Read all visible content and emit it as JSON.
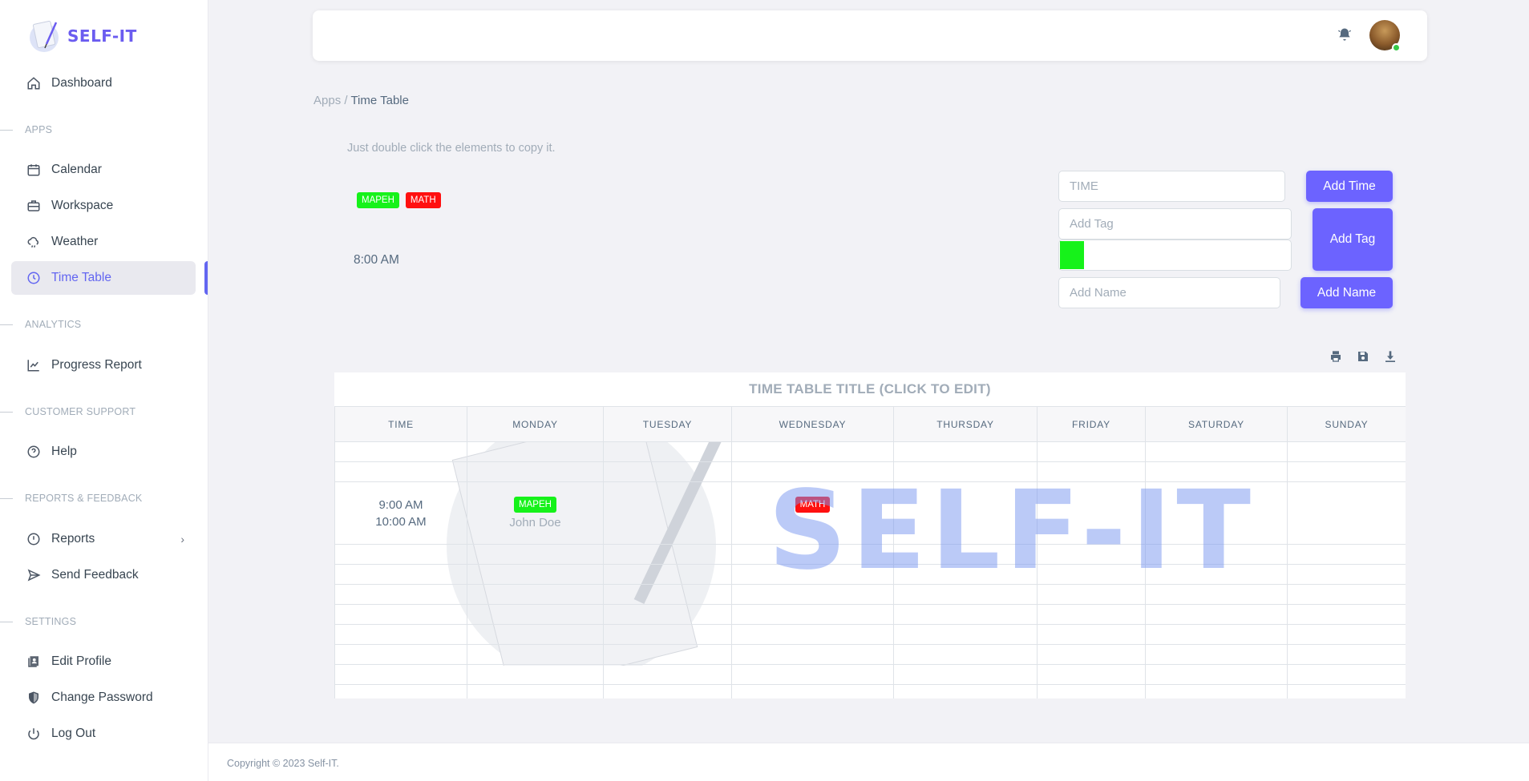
{
  "brand": {
    "name": "SELF-IT"
  },
  "sidebar": {
    "dashboard": "Dashboard",
    "sections": {
      "apps": "APPS",
      "analytics": "ANALYTICS",
      "support": "CUSTOMER SUPPORT",
      "reports": "REPORTS & FEEDBACK",
      "settings": "SETTINGS"
    },
    "items": {
      "calendar": "Calendar",
      "workspace": "Workspace",
      "weather": "Weather",
      "timetable": "Time Table",
      "progress": "Progress Report",
      "help": "Help",
      "reports": "Reports",
      "feedback": "Send Feedback",
      "edit_profile": "Edit Profile",
      "change_password": "Change Password",
      "logout": "Log Out"
    }
  },
  "breadcrumb": {
    "parent": "Apps /",
    "current": "Time Table"
  },
  "hint": "Just double click the elements to copy it.",
  "palette": {
    "tags": [
      {
        "label": "MAPEH",
        "color": "#16f21a"
      },
      {
        "label": "MATH",
        "color": "#ff1010"
      }
    ],
    "time": "8:00 AM"
  },
  "form": {
    "time_placeholder": "TIME",
    "tag_placeholder": "Add Tag",
    "name_placeholder": "Add Name",
    "selected_color": "#16f21a",
    "add_time": "Add Time",
    "add_tag": "Add Tag",
    "add_name": "Add Name"
  },
  "toolbar": {
    "icons": [
      "print-icon",
      "save-icon",
      "download-icon"
    ]
  },
  "timetable": {
    "title": "TIME TABLE TITLE (CLICK TO EDIT)",
    "headers": [
      "TIME",
      "MONDAY",
      "TUESDAY",
      "WEDNESDAY",
      "THURSDAY",
      "FRIDAY",
      "SATURDAY",
      "SUNDAY"
    ],
    "row": {
      "time_start": "9:00 AM",
      "time_end": "10:00 AM",
      "monday_tag": "MAPEH",
      "monday_name": "John Doe",
      "wednesday_tag": "MATH"
    },
    "watermark": "SELF-IT"
  },
  "footer": {
    "copyright": "Copyright © 2023 Self-IT."
  },
  "colors": {
    "accent": "#6c63ff",
    "mapeh": "#16f21a",
    "math": "#ff1010"
  }
}
